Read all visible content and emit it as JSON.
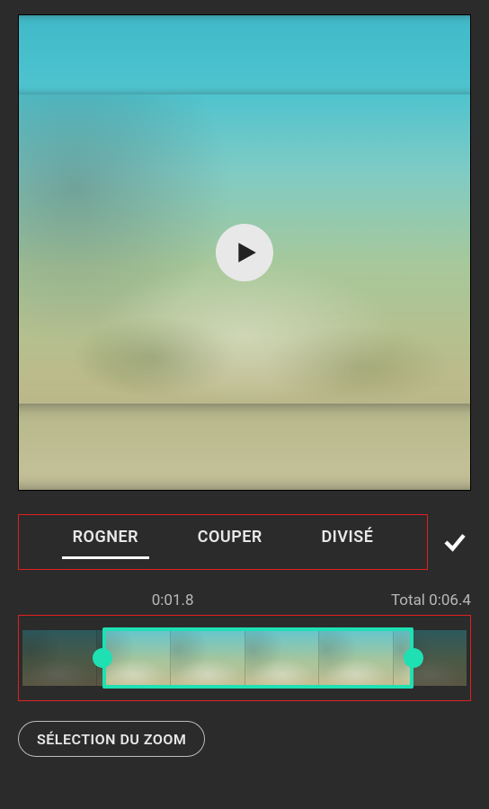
{
  "tabs": {
    "crop": "ROGNER",
    "cut": "COUPER",
    "split": "DIVISÉ",
    "active": "crop"
  },
  "time": {
    "current": "0:01.8",
    "total_label": "Total 0:06.4"
  },
  "timeline": {
    "selection_start_pct": 18,
    "selection_end_pct": 88,
    "thumb_count": 6
  },
  "zoom": {
    "label": "SÉLECTION DU ZOOM"
  },
  "colors": {
    "accent": "#1fe0b3",
    "highlight_border": "#e02020"
  }
}
